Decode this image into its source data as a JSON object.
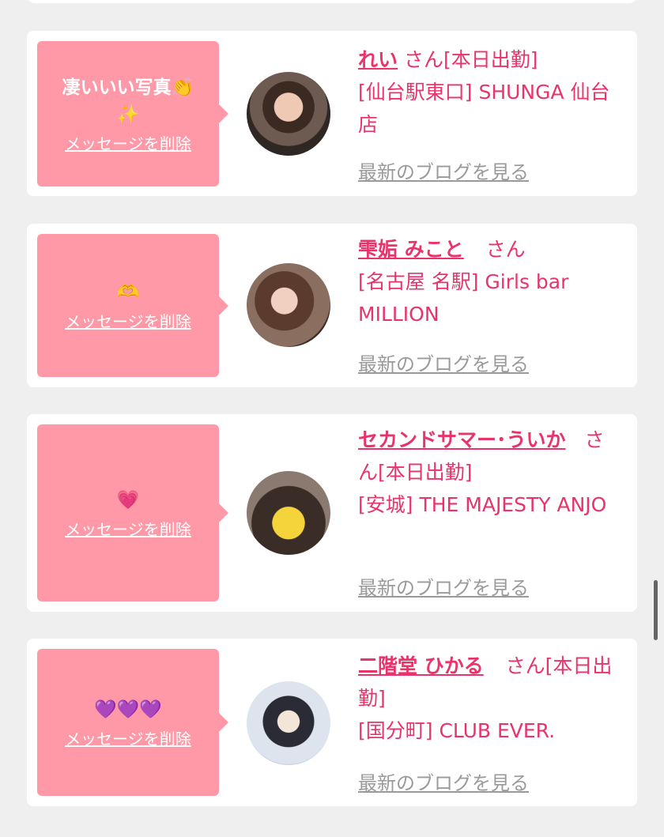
{
  "delete_label": "メッセージを削除",
  "blog_label": "最新のブログを見る",
  "cards": [
    {
      "message": "凄いいい写真👏✨",
      "name": "れい",
      "suffix": "さん[本日出勤]",
      "shop": "[仙台駅東口] SHUNGA 仙台店"
    },
    {
      "message": "🫶",
      "name": "雫姤 みこと",
      "suffix": "さん",
      "shop": "[名古屋 名駅] Girls bar MILLION"
    },
    {
      "message": "💗",
      "name": "セカンドサマー･ういか",
      "suffix": "さん[本日出勤]",
      "shop": "[安城] THE MAJESTY ANJO"
    },
    {
      "message": "💜💜💜",
      "name": "二階堂 ひかる",
      "suffix": "さん[本日出勤]",
      "shop": "[国分町] CLUB EVER."
    }
  ]
}
